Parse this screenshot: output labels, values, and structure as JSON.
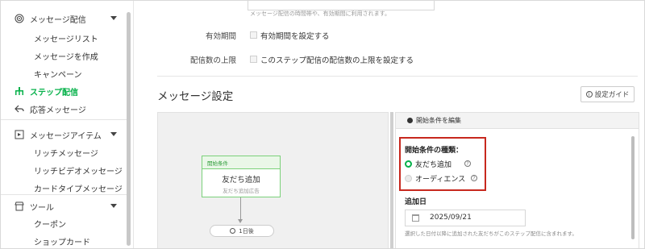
{
  "sidebar": {
    "items": [
      {
        "label": "メッセージ配信",
        "level": "top",
        "icon": "broadcast-icon",
        "caret": true
      },
      {
        "label": "メッセージリスト",
        "level": "sub"
      },
      {
        "label": "メッセージを作成",
        "level": "sub"
      },
      {
        "label": "キャンペーン",
        "level": "sub"
      },
      {
        "label": "ステップ配信",
        "level": "top",
        "icon": "step-icon",
        "active": true
      },
      {
        "label": "応答メッセージ",
        "level": "top",
        "icon": "reply-icon"
      },
      {
        "label": "メッセージアイテム",
        "level": "top",
        "icon": "item-icon",
        "caret": true
      },
      {
        "label": "リッチメッセージ",
        "level": "sub"
      },
      {
        "label": "リッチビデオメッセージ",
        "level": "sub"
      },
      {
        "label": "カードタイプメッセージ",
        "level": "sub"
      },
      {
        "label": "ツール",
        "level": "top",
        "icon": "store-icon",
        "caret": true
      },
      {
        "label": "クーポン",
        "level": "sub"
      },
      {
        "label": "ショップカード",
        "level": "sub"
      }
    ]
  },
  "form": {
    "top_hint": "メッセージ配信の時間帯や、有効期間に利用されます。",
    "validity_label": "有効期間",
    "validity_checkbox": "有効期間を設定する",
    "limit_label": "配信数の上限",
    "limit_checkbox": "このステップ配信の配信数の上限を設定する"
  },
  "section": {
    "title": "メッセージ設定",
    "guide_button": "設定ガイド"
  },
  "canvas": {
    "node_header": "開始条件",
    "node_title": "友だち追加",
    "node_sub": "友だち追加広告",
    "delay_label": "1日後"
  },
  "panel": {
    "header": "開始条件を編集",
    "condition_title": "開始条件の種類：",
    "option_friend": "友だち追加",
    "option_audience": "オーディエンス",
    "date_label": "追加日",
    "date_value": "2025/09/21",
    "date_hint": "選択した日付以降に追加された友だちがこのステップ配信に含まれます。"
  },
  "colors": {
    "accent_green": "#06b14a",
    "highlight_red": "#c7281e"
  }
}
